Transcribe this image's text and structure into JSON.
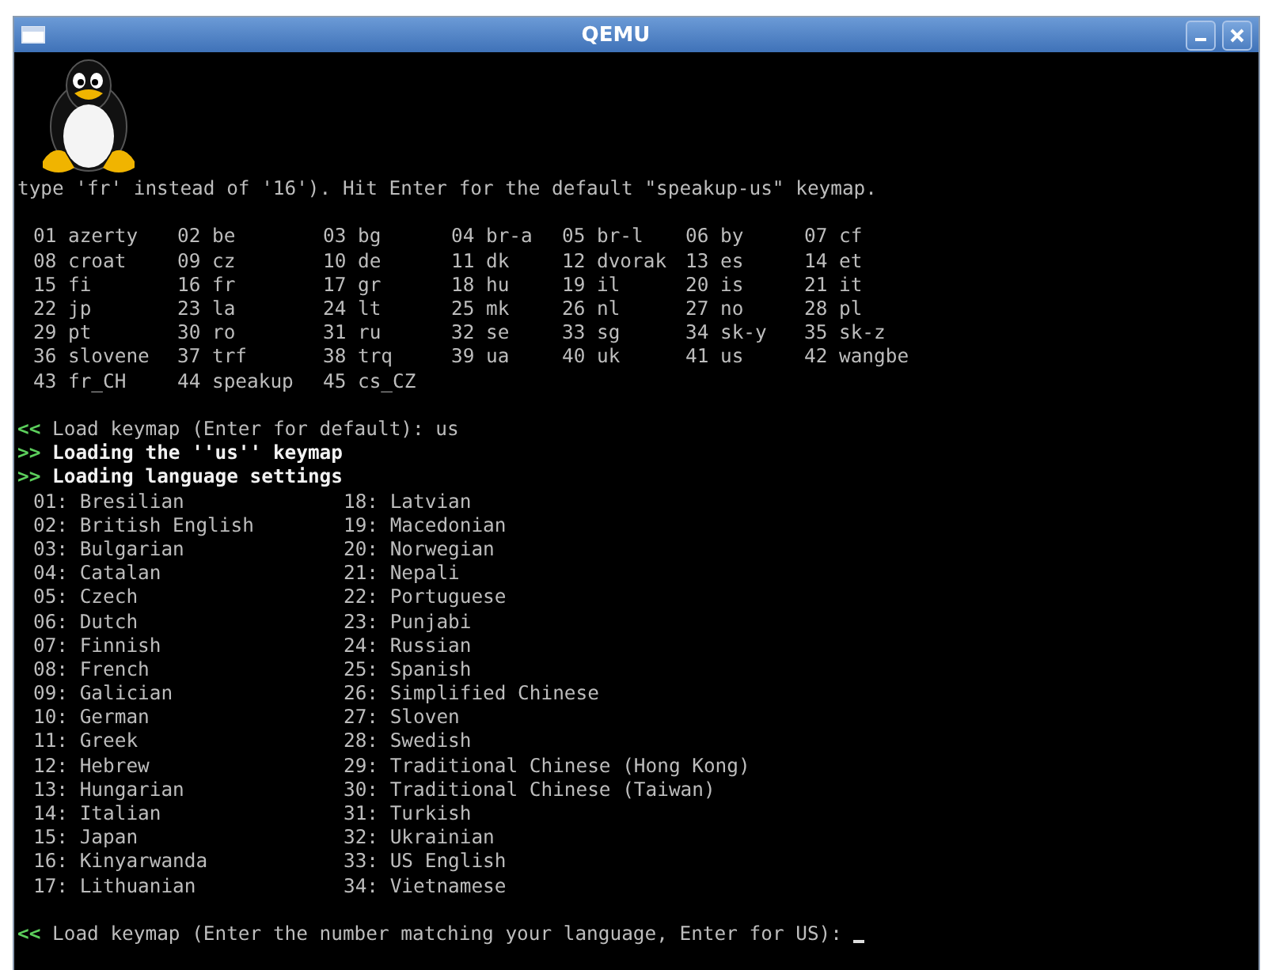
{
  "window": {
    "title": "QEMU"
  },
  "console": {
    "intro": "type 'fr' instead of '16'). Hit Enter for the default \"speakup-us\" keymap.",
    "keymaps": [
      "01 azerty",
      "02 be",
      "03 bg",
      "04 br-a",
      "05 br-l",
      "06 by",
      "07 cf",
      "08 croat",
      "09 cz",
      "10 de",
      "11 dk",
      "12 dvorak",
      "13 es",
      "14 et",
      "15 fi",
      "16 fr",
      "17 gr",
      "18 hu",
      "19 il",
      "20 is",
      "21 it",
      "22 jp",
      "23 la",
      "24 lt",
      "25 mk",
      "26 nl",
      "27 no",
      "28 pl",
      "29 pt",
      "30 ro",
      "31 ru",
      "32 se",
      "33 sg",
      "34 sk-y",
      "35 sk-z",
      "36 slovene",
      "37 trf",
      "38 trq",
      "39 ua",
      "40 uk",
      "41 us",
      "42 wangbe",
      "43 fr_CH",
      "44 speakup",
      "45 cs_CZ"
    ],
    "messages": [
      {
        "kind": "prompt",
        "marker": "<<",
        "text": "Load keymap (Enter for default): us"
      },
      {
        "kind": "status",
        "marker": ">>",
        "text": "Loading the ''us'' keymap"
      },
      {
        "kind": "status",
        "marker": ">>",
        "text": "Loading language settings"
      }
    ],
    "languages": [
      "01: Bresilian",
      "02: British English",
      "03: Bulgarian",
      "04: Catalan",
      "05: Czech",
      "06: Dutch",
      "07: Finnish",
      "08: French",
      "09: Galician",
      "10: German",
      "11: Greek",
      "12: Hebrew",
      "13: Hungarian",
      "14: Italian",
      "15: Japan",
      "16: Kinyarwanda",
      "17: Lithuanian",
      "18: Latvian",
      "19: Macedonian",
      "20: Norwegian",
      "21: Nepali",
      "22: Portuguese",
      "23: Punjabi",
      "24: Russian",
      "25: Spanish",
      "26: Simplified Chinese",
      "27: Sloven",
      "28: Swedish",
      "29: Traditional Chinese (Hong Kong)",
      "30: Traditional Chinese (Taiwan)",
      "31: Turkish",
      "32: Ukrainian",
      "33: US English",
      "34: Vietnamese"
    ],
    "final_prompt": {
      "marker": "<<",
      "text": "Load keymap (Enter the number matching your language, Enter for US):"
    }
  }
}
